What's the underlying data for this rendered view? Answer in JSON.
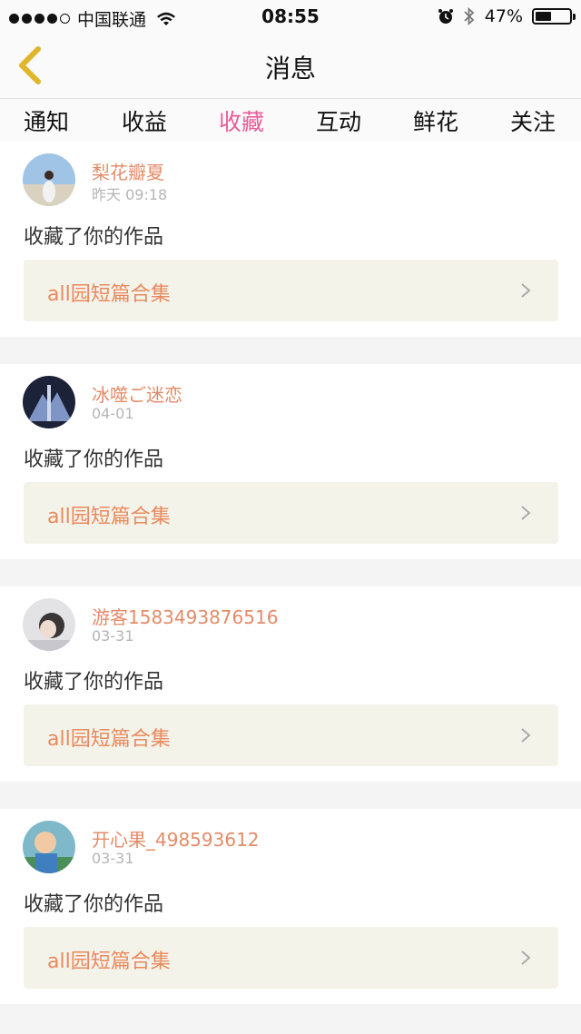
{
  "status_bar": {
    "carrier": "中国联通",
    "time": "08:55",
    "battery": "47%",
    "battery_level": 0.47
  },
  "nav": {
    "title": "消息"
  },
  "tabs": [
    {
      "label": "通知"
    },
    {
      "label": "收益"
    },
    {
      "label": "收藏"
    },
    {
      "label": "互动"
    },
    {
      "label": "鲜花"
    },
    {
      "label": "关注"
    }
  ],
  "active_tab_index": 2,
  "items": [
    {
      "name": "梨花瓣夏",
      "time": "昨天 09:18",
      "action": "收藏了你的作品",
      "work": "all园短篇合集"
    },
    {
      "name": "冰噬ご迷恋",
      "time": "04-01",
      "action": "收藏了你的作品",
      "work": "all园短篇合集"
    },
    {
      "name": "游客1583493876516",
      "time": "03-31",
      "action": "收藏了你的作品",
      "work": "all园短篇合集"
    },
    {
      "name": "开心果_498593612",
      "time": "03-31",
      "action": "收藏了你的作品",
      "work": "all园短篇合集"
    }
  ],
  "icons": {
    "back": "chevron-left-icon",
    "item_arrow": "chevron-right-icon",
    "wifi": "wifi-icon",
    "alarm": "alarm-icon",
    "bluetooth": "bluetooth-icon",
    "battery": "battery-icon"
  },
  "colors": {
    "accent": "#e85c9a",
    "username": "#e38b68",
    "work_title": "#e88a5e",
    "back_icon": "#e0b62a"
  }
}
